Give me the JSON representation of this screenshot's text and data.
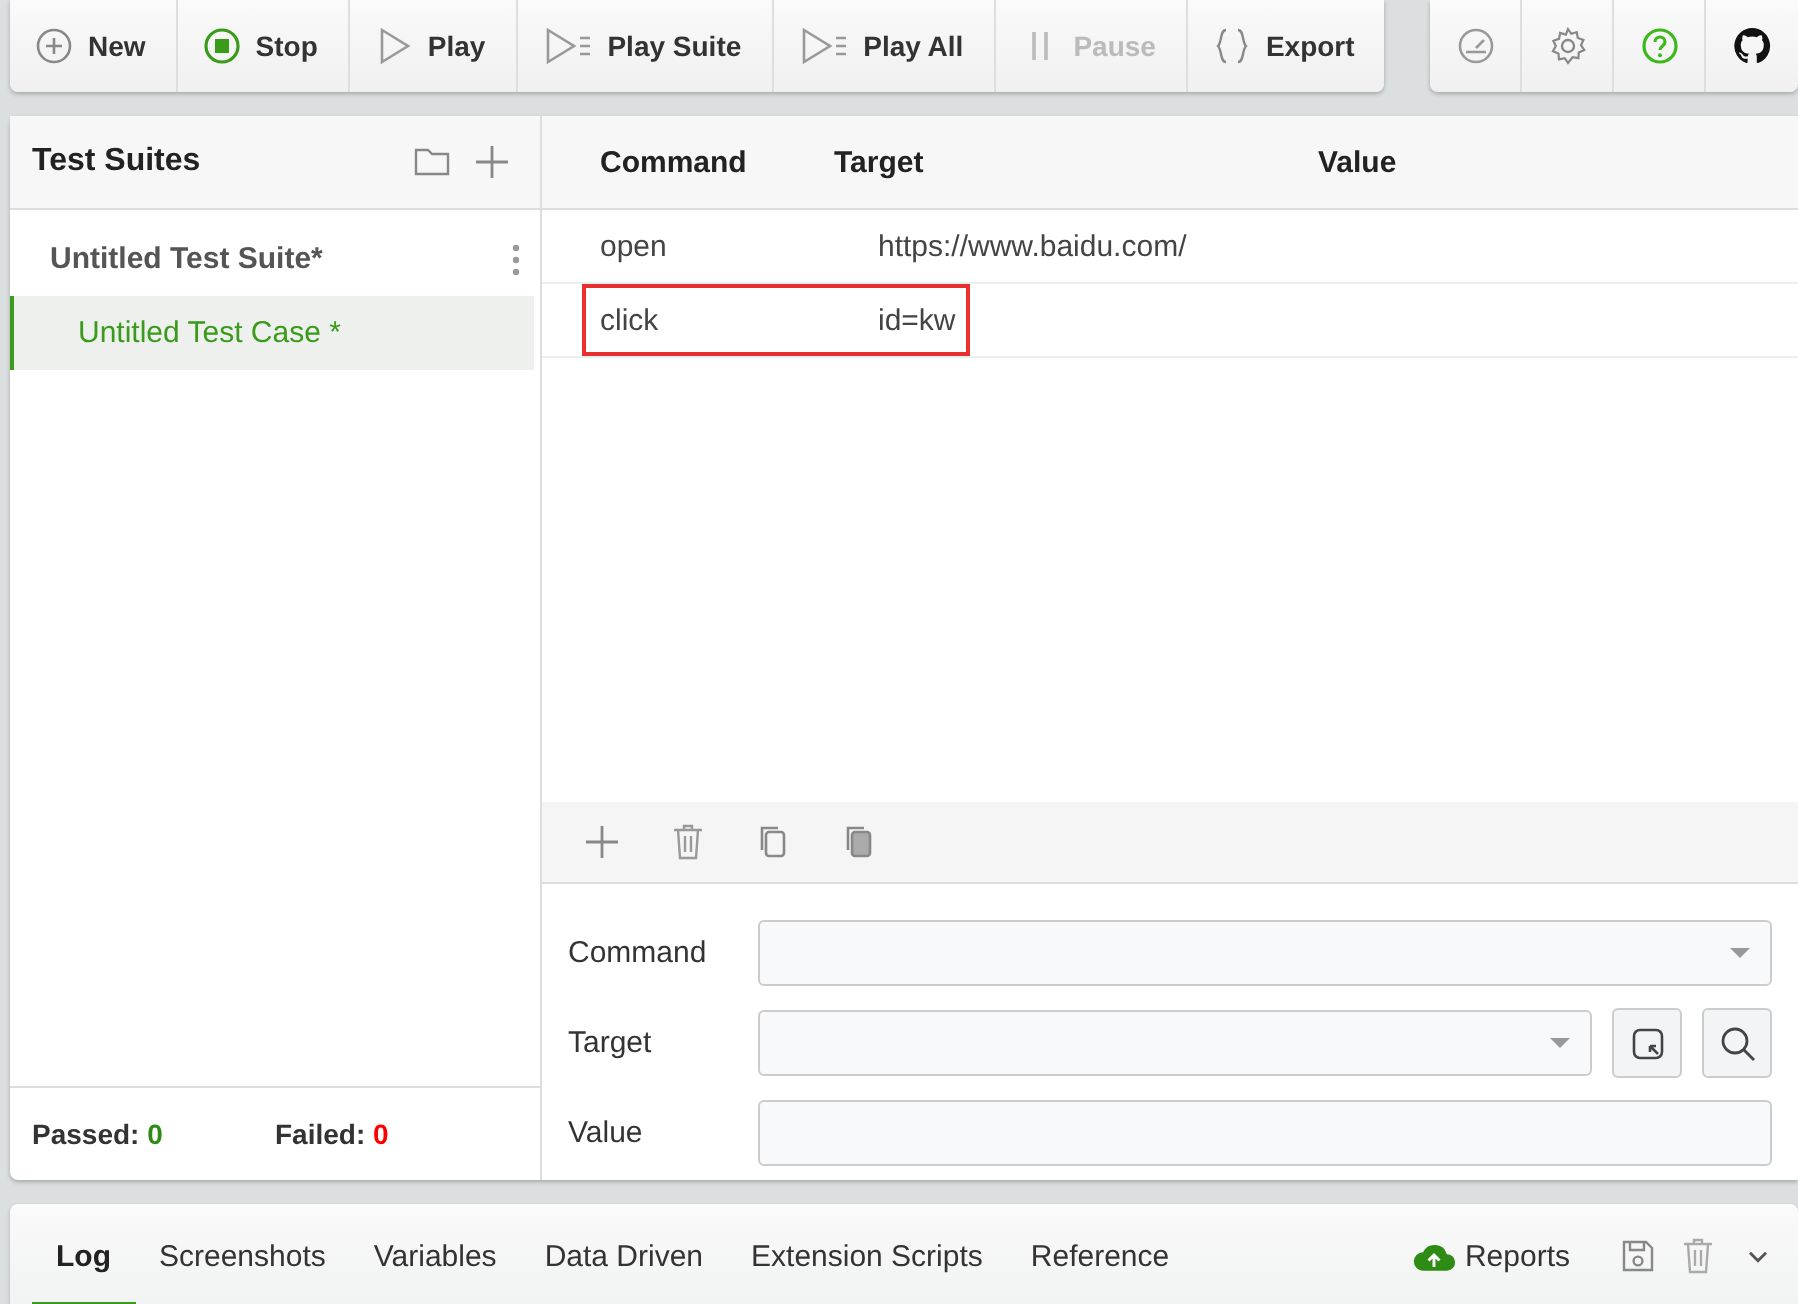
{
  "toolbar": {
    "buttons": [
      {
        "label": "New",
        "disabled": false
      },
      {
        "label": "Stop",
        "disabled": false
      },
      {
        "label": "Play",
        "disabled": false
      },
      {
        "label": "Play Suite",
        "disabled": false
      },
      {
        "label": "Play All",
        "disabled": false
      },
      {
        "label": "Pause",
        "disabled": true
      },
      {
        "label": "Export",
        "disabled": false
      }
    ]
  },
  "sidebar": {
    "title": "Test Suites",
    "suites": [
      {
        "name": "Untitled Test Suite*",
        "cases": [
          {
            "name": "Untitled Test Case *",
            "selected": true
          }
        ]
      }
    ],
    "passed": {
      "label": "Passed:",
      "count": "0"
    },
    "failed": {
      "label": "Failed:",
      "count": "0"
    }
  },
  "table": {
    "columns": [
      "Command",
      "Target",
      "Value"
    ],
    "rows": [
      {
        "command": "open",
        "target": "https://www.baidu.com/",
        "highlighted": false
      },
      {
        "command": "click",
        "target": "id=kw",
        "highlighted": true
      }
    ]
  },
  "editor": {
    "fields": [
      {
        "label": "Command",
        "kind": "combo"
      },
      {
        "label": "Target",
        "kind": "combo-tools"
      },
      {
        "label": "Value",
        "kind": "text"
      }
    ]
  },
  "bottom": {
    "tabs": [
      {
        "label": "Log",
        "selected": true
      },
      {
        "label": "Screenshots",
        "selected": false
      },
      {
        "label": "Variables",
        "selected": false
      },
      {
        "label": "Data Driven",
        "selected": false
      },
      {
        "label": "Extension Scripts",
        "selected": false
      },
      {
        "label": "Reference",
        "selected": false
      }
    ],
    "reports": "Reports"
  }
}
